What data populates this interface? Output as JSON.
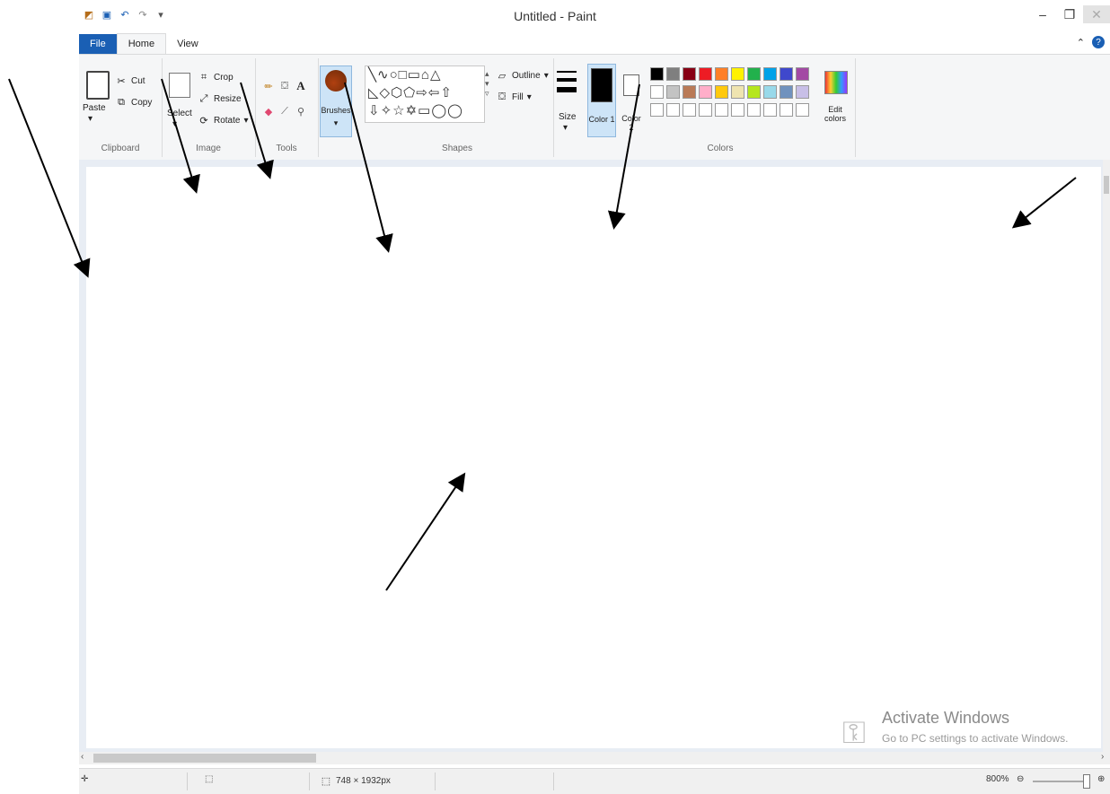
{
  "window": {
    "title": "Untitled - Paint"
  },
  "quick_access": {
    "icons": [
      "paint-app-icon",
      "save-icon",
      "undo-icon",
      "redo-icon",
      "customize-dropdown-icon"
    ]
  },
  "window_controls": {
    "minimize": "–",
    "restore": "❐"
  },
  "tabs": [
    {
      "label": "File"
    },
    {
      "label": "Home"
    },
    {
      "label": "View"
    }
  ],
  "ribbon": {
    "clipboard": {
      "paste": "Paste",
      "cut": "Cut",
      "copy": "Copy",
      "group": "Clipboard"
    },
    "image": {
      "select": "Select",
      "crop": "Crop",
      "resize": "Resize",
      "rotate": "Rotate",
      "group": "Image"
    },
    "tools": {
      "group": "Tools"
    },
    "brushes": {
      "label": "Brushes"
    },
    "shapes": {
      "outline": "Outline",
      "fill": "Fill",
      "group": "Shapes"
    },
    "size": {
      "label": "Size"
    },
    "colors": {
      "color1": "Color 1",
      "color2": "Color 2",
      "edit": "Edit colors",
      "group": "Colors",
      "palette_row1": [
        "#000000",
        "#7f7f7f",
        "#880015",
        "#ed1c24",
        "#ff7f27",
        "#fff200",
        "#22b14c",
        "#00a2e8",
        "#3f48cc",
        "#a349a4"
      ],
      "palette_row2": [
        "#ffffff",
        "#c3c3c3",
        "#b97a57",
        "#ffaec9",
        "#ffc90e",
        "#efe4b0",
        "#b5e61d",
        "#99d9ea",
        "#7092be",
        "#c8bfe7"
      ]
    }
  },
  "status": {
    "dimensions": "748 × 1932px",
    "zoom": "800%"
  },
  "watermark": {
    "title": "Activate Windows",
    "subtitle": "Go to PC settings to activate Windows."
  }
}
